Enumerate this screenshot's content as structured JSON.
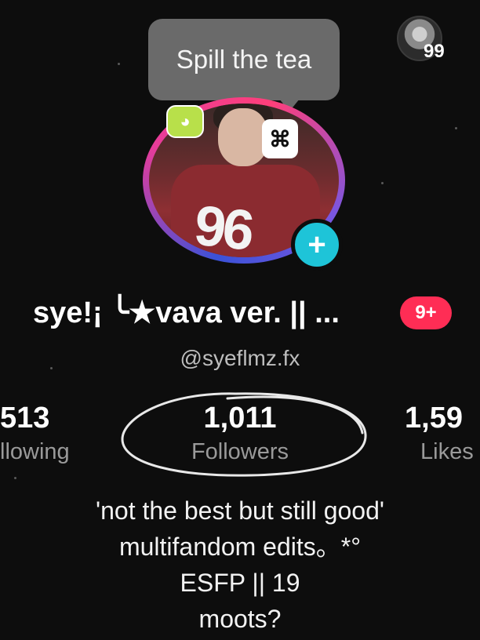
{
  "tooltip": {
    "text": "Spill the tea"
  },
  "mini_avatar": {
    "count": "99"
  },
  "profile": {
    "display_name": "sye!¡ ╰★vava ver. || ...",
    "badge": "9+",
    "username": "@syeflmz.fx",
    "add_icon": "plus-icon",
    "stickers": {
      "left": "cat-sticker-icon",
      "right": "capcut-logo-icon"
    }
  },
  "stats": {
    "following": {
      "value": "513",
      "label": "llowing"
    },
    "followers": {
      "value": "1,011",
      "label": "Followers"
    },
    "likes": {
      "value": "1,59",
      "label": "Likes"
    }
  },
  "bio": {
    "lines": [
      "'not the best but still good'",
      "multifandom edits。*°",
      "ESFP || 19",
      "moots?"
    ]
  },
  "colors": {
    "background": "#0d0d0d",
    "accent_cyan": "#1ec4d8",
    "badge_red": "#ff2d55",
    "tooltip_gray": "#6a6a6a"
  }
}
